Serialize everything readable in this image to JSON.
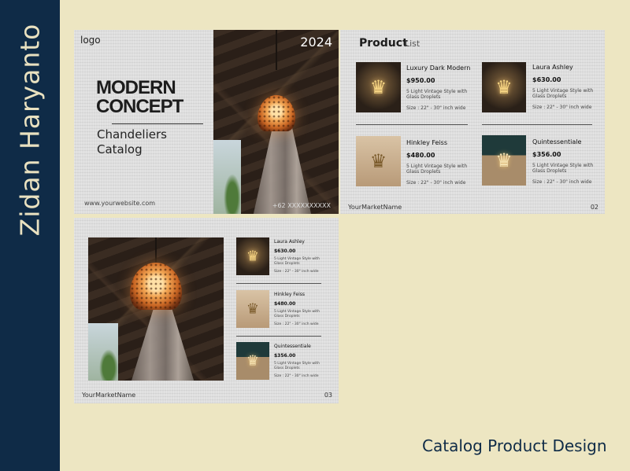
{
  "designer_name": "Zidan Haryanto",
  "footer_title": "Catalog Product Design",
  "cover": {
    "logo": "logo",
    "year": "2024",
    "headline_line1": "MODERN",
    "headline_line2": "CONCEPT",
    "subtitle_line1": "Chandeliers",
    "subtitle_line2": "Catalog",
    "website": "www.yourwebsite.com",
    "phone": "+62 XXXXXXXXXX"
  },
  "spread2": {
    "heading_bold": "Product",
    "heading_light": "List",
    "footer_name": "YourMarketName",
    "page_number": "02",
    "products": [
      {
        "name": "Luxury Dark Modern",
        "price": "$950.00",
        "desc_line1": "5 Light Vintage Style with",
        "desc_line2": "Glass Droplets",
        "size": "Size : 22\" - 30\" inch wide"
      },
      {
        "name": "Laura Ashley",
        "price": "$630.00",
        "desc_line1": "5 Light Vintage Style with",
        "desc_line2": "Glass Droplets",
        "size": "Size : 22\" - 30\" inch wide"
      },
      {
        "name": "Hinkley Feiss",
        "price": "$480.00",
        "desc_line1": "5 Light Vintage Style with",
        "desc_line2": "Glass Droplets",
        "size": "Size : 22\" - 30\" inch wide"
      },
      {
        "name": "Quintessentiale",
        "price": "$356.00",
        "desc_line1": "5 Light Vintage Style with",
        "desc_line2": "Glass Droplets",
        "size": "Size : 22\" - 30\" inch wide"
      }
    ]
  },
  "spread3": {
    "footer_name": "YourMarketName",
    "page_number": "03",
    "products": [
      {
        "name": "Laura Ashley",
        "price": "$630.00",
        "desc_line1": "5 Light Vintage Style with",
        "desc_line2": "Glass Droplets",
        "size": "Size : 22\" - 30\" inch wide"
      },
      {
        "name": "Hinkley Feiss",
        "price": "$480.00",
        "desc_line1": "5 Light Vintage Style with",
        "desc_line2": "Glass Droplets",
        "size": "Size : 22\" - 30\" inch wide"
      },
      {
        "name": "Quintessentiale",
        "price": "$356.00",
        "desc_line1": "5 Light Vintage Style with",
        "desc_line2": "Glass Droplets",
        "size": "Size : 22\" - 30\" inch wide"
      }
    ]
  },
  "colors": {
    "background": "#ede6c2",
    "sidebar": "#0f2b47",
    "sidebar_text": "#e9e1c0",
    "footer_title": "#0f2b47"
  },
  "icons": [
    "chandelier-icon"
  ]
}
